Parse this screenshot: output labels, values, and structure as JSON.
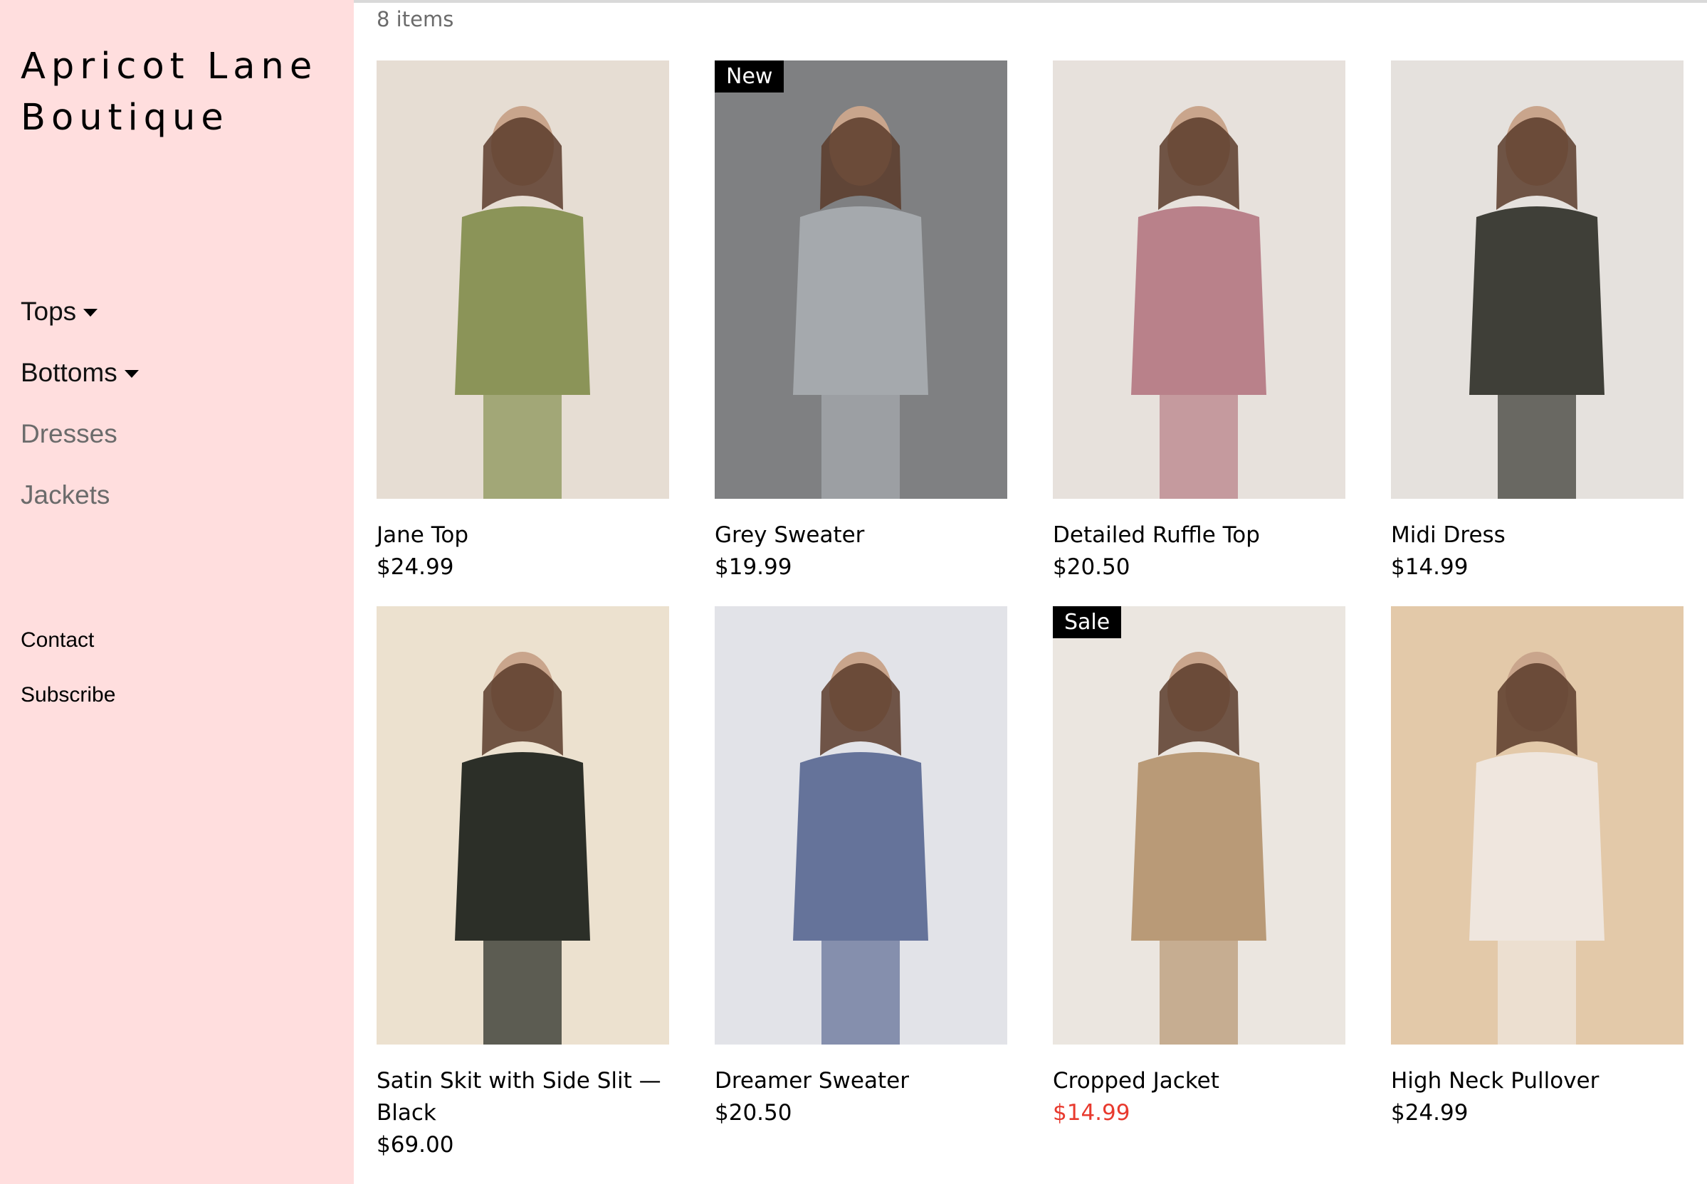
{
  "brand": {
    "line1": "Apricot Lane",
    "line2": "Boutique"
  },
  "nav": [
    {
      "label": "Tops",
      "dropdown": true
    },
    {
      "label": "Bottoms",
      "dropdown": true
    },
    {
      "label": "Dresses",
      "dropdown": false
    },
    {
      "label": "Jackets",
      "dropdown": false
    }
  ],
  "links": [
    {
      "label": "Contact"
    },
    {
      "label": "Subscribe"
    }
  ],
  "catalog": {
    "count_label": "8 items"
  },
  "products": [
    {
      "name": "Jane Top",
      "price": "$24.99",
      "badge": "",
      "on_sale": false,
      "bg": "#e6ddd3",
      "garment": "#8b9458"
    },
    {
      "name": "Grey Sweater",
      "price": "$19.99",
      "badge": "New",
      "on_sale": false,
      "bg": "#7f8082",
      "garment": "#a5a9ad"
    },
    {
      "name": "Detailed Ruffle Top",
      "price": "$20.50",
      "badge": "",
      "on_sale": false,
      "bg": "#e7e1dc",
      "garment": "#b9818a"
    },
    {
      "name": "Midi Dress",
      "price": "$14.99",
      "badge": "",
      "on_sale": false,
      "bg": "#e5e1dd",
      "garment": "#3f3f38"
    },
    {
      "name": "Satin Skit with Side Slit — Black",
      "price": "$69.00",
      "badge": "",
      "on_sale": false,
      "bg": "#ece1cf",
      "garment": "#2c2f28"
    },
    {
      "name": "Dreamer Sweater",
      "price": "$20.50",
      "badge": "",
      "on_sale": false,
      "bg": "#e2e3e8",
      "garment": "#65739a"
    },
    {
      "name": "Cropped Jacket",
      "price": "$14.99",
      "badge": "Sale",
      "on_sale": true,
      "bg": "#ebe6e0",
      "garment": "#b99a77"
    },
    {
      "name": "High Neck Pullover",
      "price": "$24.99",
      "badge": "",
      "on_sale": false,
      "bg": "#e3c9a9",
      "garment": "#efe6de"
    }
  ],
  "colors": {
    "sidebar_bg": "#ffdede",
    "sale_price": "#e83a2e",
    "badge_bg": "#000000"
  }
}
